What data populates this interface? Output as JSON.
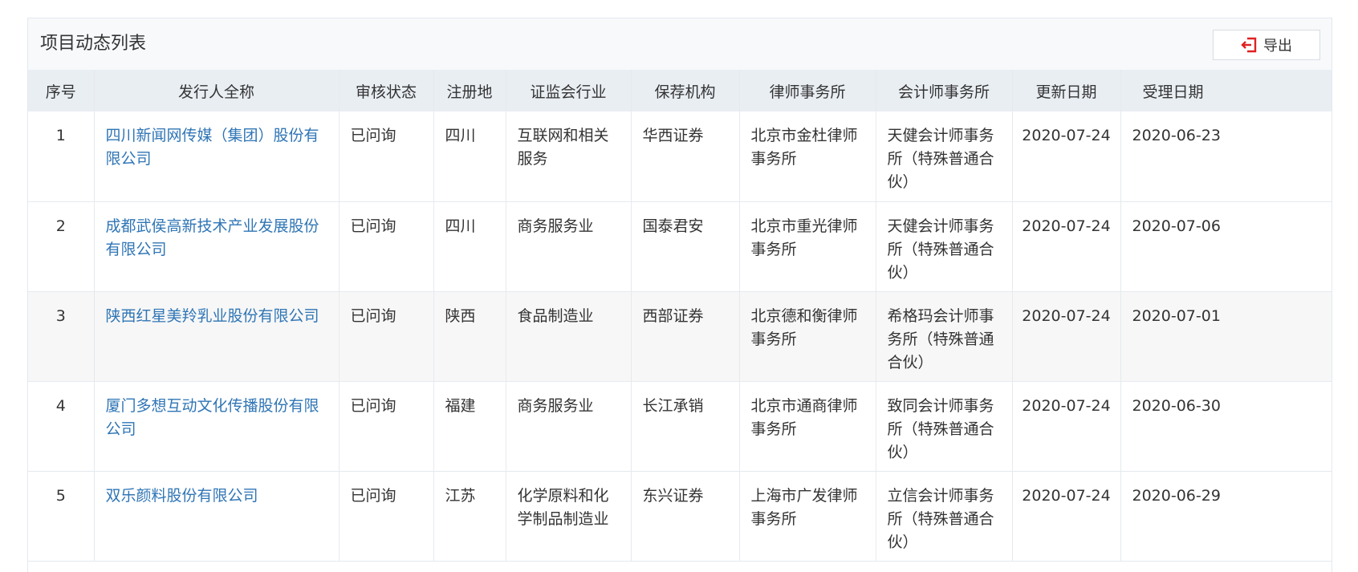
{
  "panel": {
    "title": "项目动态列表",
    "export_label": "导出",
    "accent_color": "#e02020",
    "link_color": "#2f75b5"
  },
  "columns": [
    "序号",
    "发行人全称",
    "审核状态",
    "注册地",
    "证监会行业",
    "保荐机构",
    "律师事务所",
    "会计师事务所",
    "更新日期",
    "受理日期"
  ],
  "rows": [
    {
      "idx": "1",
      "issuer": "四川新闻网传媒（集团）股份有限公司",
      "status": "已问询",
      "region": "四川",
      "industry": "互联网和相关服务",
      "sponsor": "华西证券",
      "law_firm": "北京市金杜律师事务所",
      "accounting_firm": "天健会计师事务所（特殊普通合伙）",
      "updated": "2020-07-24",
      "accepted": "2020-06-23"
    },
    {
      "idx": "2",
      "issuer": "成都武侯高新技术产业发展股份有限公司",
      "status": "已问询",
      "region": "四川",
      "industry": "商务服务业",
      "sponsor": "国泰君安",
      "law_firm": "北京市重光律师事务所",
      "accounting_firm": "天健会计师事务所（特殊普通合伙）",
      "updated": "2020-07-24",
      "accepted": "2020-07-06"
    },
    {
      "idx": "3",
      "issuer": "陕西红星美羚乳业股份有限公司",
      "status": "已问询",
      "region": "陕西",
      "industry": "食品制造业",
      "sponsor": "西部证券",
      "law_firm": "北京德和衡律师事务所",
      "accounting_firm": "希格玛会计师事务所（特殊普通合伙）",
      "updated": "2020-07-24",
      "accepted": "2020-07-01"
    },
    {
      "idx": "4",
      "issuer": "厦门多想互动文化传播股份有限公司",
      "status": "已问询",
      "region": "福建",
      "industry": "商务服务业",
      "sponsor": "长江承销",
      "law_firm": "北京市通商律师事务所",
      "accounting_firm": "致同会计师事务所（特殊普通合伙）",
      "updated": "2020-07-24",
      "accepted": "2020-06-30"
    },
    {
      "idx": "5",
      "issuer": "双乐颜料股份有限公司",
      "status": "已问询",
      "region": "江苏",
      "industry": "化学原料和化学制品制造业",
      "sponsor": "东兴证券",
      "law_firm": "上海市广发律师事务所",
      "accounting_firm": "立信会计师事务所（特殊普通合伙）",
      "updated": "2020-07-24",
      "accepted": "2020-06-29"
    }
  ]
}
